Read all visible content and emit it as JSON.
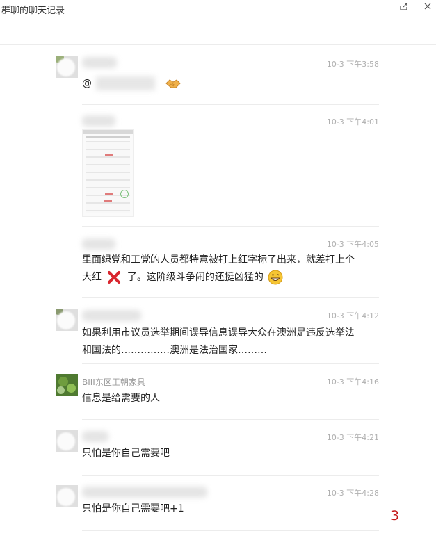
{
  "window": {
    "title": "群聊的聊天记录",
    "share_icon": "share-icon",
    "close_icon": "close-icon"
  },
  "messages": [
    {
      "sender": "",
      "time": "10-3 下午3:58",
      "text": "@",
      "emoji": "handshake-emoji"
    },
    {
      "sender": "",
      "time": "10-3 下午4:01",
      "type": "image",
      "image_desc": "screenshot-thumbnail"
    },
    {
      "sender": "",
      "time": "10-3 下午4:05",
      "text_line1": "里面绿党和工党的人员都特意被打上红字标了出来，就差打上个",
      "text_line2_a": "大红",
      "text_line2_b": "了。这阶级斗争闹的还挺凶猛的",
      "icons": [
        "red-x-icon",
        "grin-emoji"
      ]
    },
    {
      "sender": "",
      "time": "10-3 下午4:12",
      "text_line1": "如果利用市议员选举期间误导信息误导大众在澳洲是违反选举法",
      "text_line2": "和国法的……………澳洲是法治国家………"
    },
    {
      "sender": "BIII东区王朝家具",
      "time": "10-3 下午4:16",
      "text": "信息是给需要的人"
    },
    {
      "sender": "",
      "time": "10-3 下午4:21",
      "text": "只怕是你自己需要吧"
    },
    {
      "sender": "",
      "time": "10-3 下午4:28",
      "text": "只怕是你自己需要吧+1"
    }
  ],
  "page_number": "3"
}
